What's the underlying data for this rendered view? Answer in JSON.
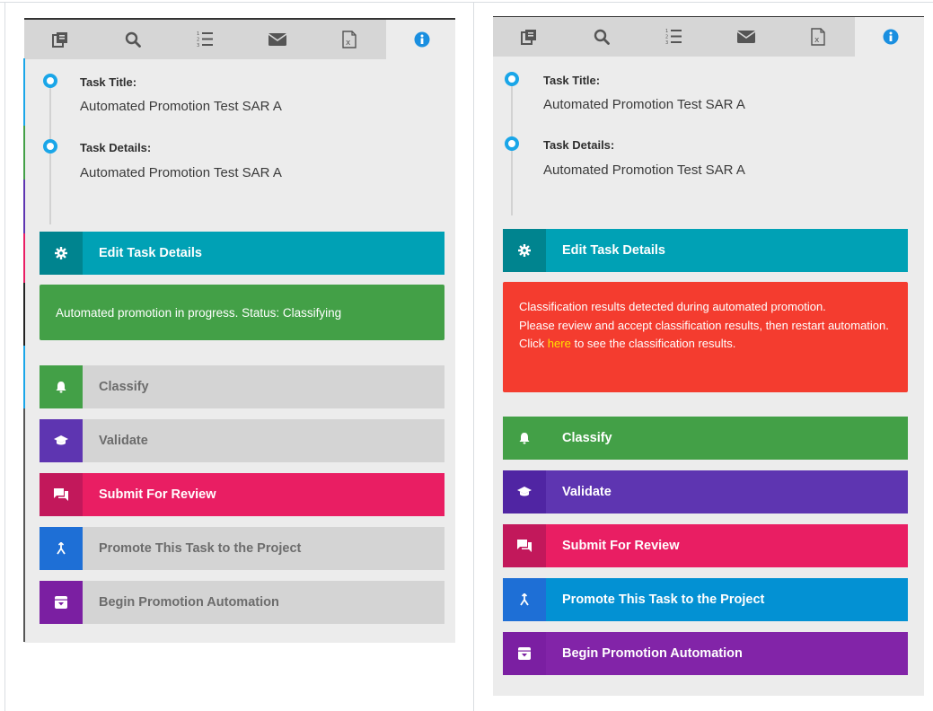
{
  "tabs": [
    {
      "name": "documents-icon"
    },
    {
      "name": "search-icon"
    },
    {
      "name": "ordered-list-icon"
    },
    {
      "name": "envelope-icon"
    },
    {
      "name": "excel-file-icon"
    },
    {
      "name": "info-icon",
      "active": true
    }
  ],
  "colors": {
    "teal": "#00a1b5",
    "green": "#43a047",
    "purple": "#5e35b1",
    "pink": "#e91e63",
    "blue": "#0288d1",
    "violet": "#7b1fa2",
    "red": "#f43c2f",
    "timeline_dot": "#1aa6e8"
  },
  "left": {
    "task_title_label": "Task Title:",
    "task_title_value": "Automated Promotion Test SAR A",
    "task_details_label": "Task Details:",
    "task_details_value": "Automated Promotion Test SAR A",
    "edit_label": "Edit Task Details",
    "status_message": "Automated promotion in progress. Status: Classifying",
    "actions": [
      {
        "label": "Classify",
        "enabled": false
      },
      {
        "label": "Validate",
        "enabled": false
      },
      {
        "label": "Submit For Review",
        "enabled": true
      },
      {
        "label": "Promote This Task to the Project",
        "enabled": false
      },
      {
        "label": "Begin Promotion Automation",
        "enabled": false
      }
    ]
  },
  "right": {
    "task_title_label": "Task Title:",
    "task_title_value": "Automated Promotion Test SAR A",
    "task_details_label": "Task Details:",
    "task_details_value": "Automated Promotion Test SAR A",
    "edit_label": "Edit Task Details",
    "alert_line1": "Classification results detected during automated promotion.",
    "alert_line2": "Please review and accept classification results, then restart automation.",
    "alert_click": "Click",
    "alert_link": "here",
    "alert_line3_end": "to see the classification results.",
    "actions": [
      {
        "label": "Classify",
        "enabled": true
      },
      {
        "label": "Validate",
        "enabled": true
      },
      {
        "label": "Submit For Review",
        "enabled": true
      },
      {
        "label": "Promote This Task to the Project",
        "enabled": true
      },
      {
        "label": "Begin Promotion Automation",
        "enabled": true
      }
    ]
  }
}
